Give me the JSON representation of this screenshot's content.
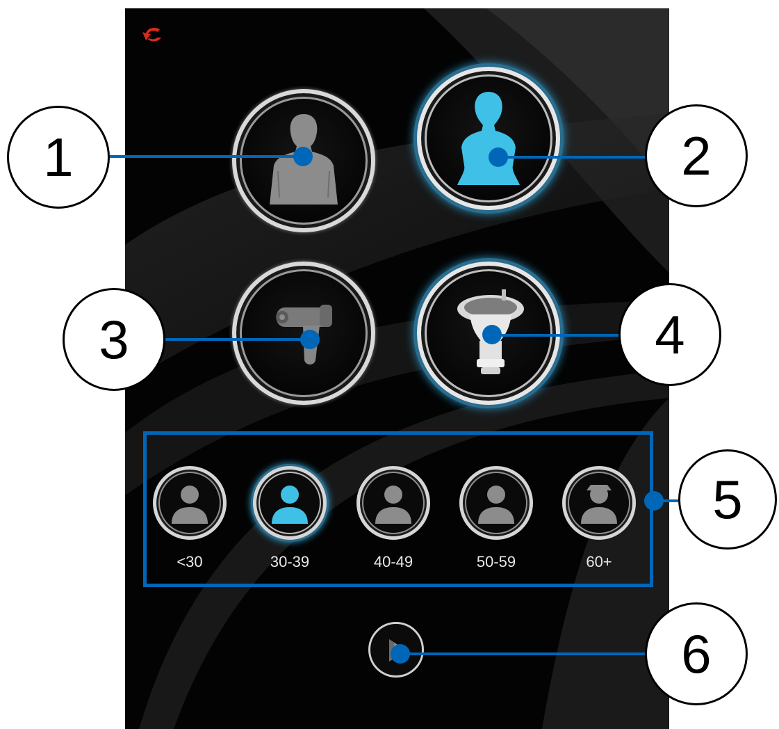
{
  "callouts": [
    "1",
    "2",
    "3",
    "4",
    "5",
    "6"
  ],
  "age_groups": [
    {
      "label": "<30",
      "selected": false
    },
    {
      "label": "30-39",
      "selected": true
    },
    {
      "label": "40-49",
      "selected": false
    },
    {
      "label": "50-59",
      "selected": false
    },
    {
      "label": "60+",
      "selected": false
    }
  ],
  "selection": {
    "sex": "female",
    "device": "cup-probe"
  },
  "colors": {
    "accent": "#3fc0e6",
    "annotation": "#0067b8",
    "back_arrow": "#d82a1e",
    "icon_inactive": "#8c8c8c"
  },
  "icons": {
    "back": "back-arrow-icon",
    "male": "male-silhouette-icon",
    "female": "female-silhouette-icon",
    "handheld": "handheld-probe-icon",
    "cup": "cup-probe-icon",
    "play": "play-icon"
  }
}
